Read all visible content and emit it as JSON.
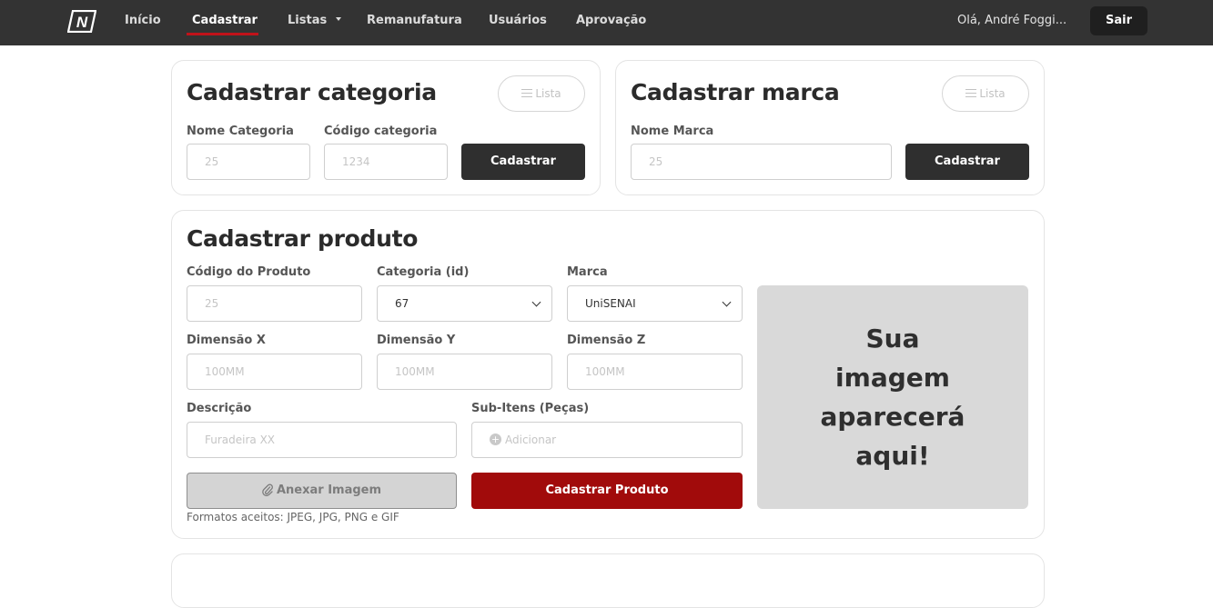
{
  "navbar": {
    "logo_letter": "N",
    "items": [
      {
        "label": "Início"
      },
      {
        "label": "Cadastrar"
      },
      {
        "label": "Listas"
      },
      {
        "label": "Remanufatura"
      },
      {
        "label": "Usuários"
      },
      {
        "label": "Aprovação"
      }
    ],
    "active_item": "Cadastrar",
    "greeting": "Olá, André Foggi...",
    "logout_label": "Sair"
  },
  "category_card": {
    "title": "Cadastrar categoria",
    "list_button": "Lista",
    "name_label": "Nome Categoria",
    "name_placeholder": "25",
    "code_label": "Código categoria",
    "code_placeholder": "1234",
    "submit_label": "Cadastrar"
  },
  "brand_card": {
    "title": "Cadastrar marca",
    "list_button": "Lista",
    "name_label": "Nome Marca",
    "name_placeholder": "25",
    "submit_label": "Cadastrar"
  },
  "product_card": {
    "title": "Cadastrar produto",
    "code_label": "Código do Produto",
    "code_placeholder": "25",
    "category_label": "Categoria (id)",
    "category_value": "67",
    "brand_label": "Marca",
    "brand_value": "UniSENAI",
    "dim_x_label": "Dimensão X",
    "dim_x_placeholder": "100MM",
    "dim_y_label": "Dimensão Y",
    "dim_y_placeholder": "100MM",
    "dim_z_label": "Dimensão Z",
    "dim_z_placeholder": "100MM",
    "description_label": "Descrição",
    "description_placeholder": "Furadeira XX",
    "subitems_label": "Sub-Itens (Peças)",
    "subitems_placeholder": "Adicionar",
    "attach_label": "Anexar Imagem",
    "submit_label": "Cadastrar Produto",
    "formats_hint": "Formatos aceitos: JPEG, JPG, PNG e GIF",
    "preview_text": "Sua imagem aparecerá aqui!"
  },
  "colors": {
    "navbar_bg": "#333333",
    "accent_red": "#a10b0b",
    "dark_button": "#2f2f2f",
    "preview_bg": "#d9d9d9"
  }
}
